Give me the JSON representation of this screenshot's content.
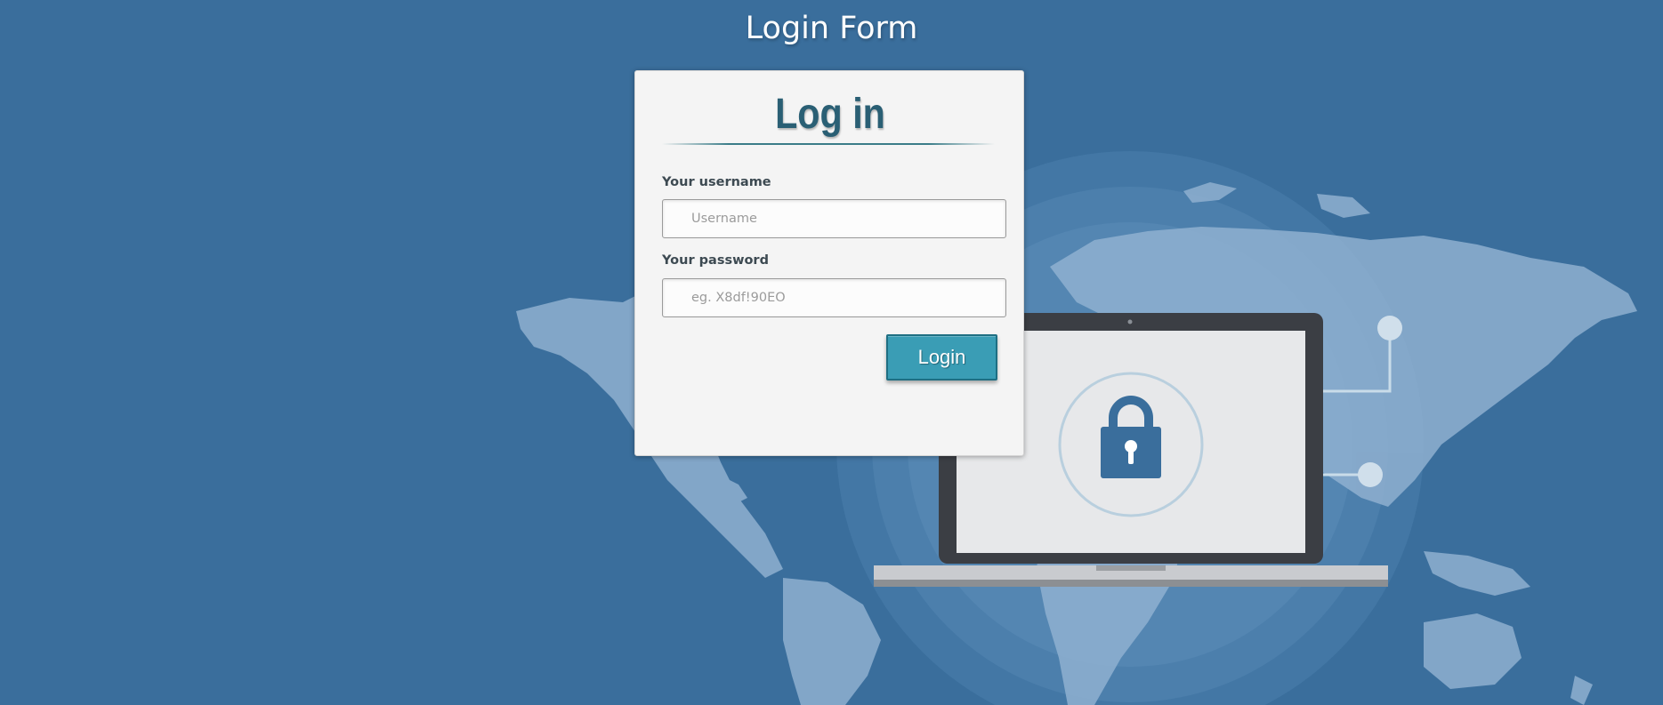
{
  "page": {
    "title": "Login Form"
  },
  "form": {
    "heading": "Log in",
    "username_label": "Your username",
    "username_placeholder": "Username",
    "username_value": "",
    "password_label": "Your password",
    "password_placeholder": "eg. X8df!90EO",
    "password_value": "",
    "login_label": "Login"
  },
  "colors": {
    "background": "#3a6e9c",
    "card": "#f4f4f4",
    "heading": "#2a5f74",
    "button": "#3a9db5"
  },
  "background_art": {
    "description_icons": [
      "world-map",
      "laptop-icon",
      "padlock-icon"
    ]
  }
}
